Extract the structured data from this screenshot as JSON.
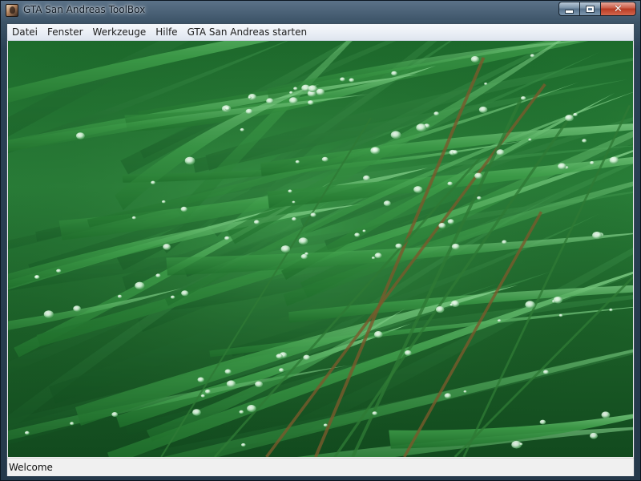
{
  "window": {
    "title": "GTA San Andreas ToolBox",
    "icon": "gta-character-icon"
  },
  "caption_buttons": {
    "minimize": "minimize-icon",
    "maximize": "maximize-icon",
    "close": "close-icon"
  },
  "menu": {
    "items": [
      {
        "label": "Datei"
      },
      {
        "label": "Fenster"
      },
      {
        "label": "Werkzeuge"
      },
      {
        "label": "Hilfe"
      },
      {
        "label": "GTA San Andreas starten"
      }
    ]
  },
  "content": {
    "background": "grass-blades-with-dew-drops-wallpaper"
  },
  "status": {
    "text": "Welcome"
  },
  "colors": {
    "grass_dark": "#0f4a1e",
    "grass_mid": "#2e8a3c",
    "grass_light": "#7fd08a",
    "close_button": "#c4452c"
  }
}
